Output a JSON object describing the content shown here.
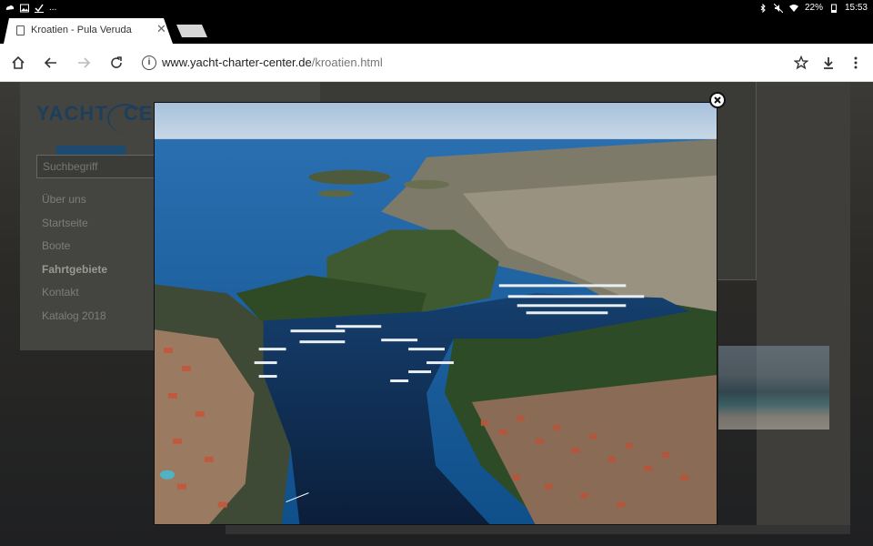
{
  "status_bar": {
    "left_icons": [
      "weather-icon",
      "image-icon",
      "check-icon",
      "more-icon"
    ],
    "more_text": "...",
    "battery": "22%",
    "time": "15:53"
  },
  "tab": {
    "title": "Kroatien - Pula Veruda",
    "close": "✕"
  },
  "toolbar": {
    "url_host": "www.yacht-charter-center.de",
    "url_path": "/kroatien.html"
  },
  "page": {
    "logo_text": "YACHT",
    "logo_text_2": "CEN",
    "search_placeholder": "Suchbegriff",
    "nav": [
      {
        "label": "Über uns"
      },
      {
        "label": "Startseite"
      },
      {
        "label": "Boote"
      },
      {
        "label": "Fahrtgebiete",
        "active": true
      },
      {
        "label": "Kontakt"
      },
      {
        "label": "Katalog 2018"
      }
    ]
  },
  "lightbox": {
    "image": "aerial-photo-pula-veruda-marina",
    "close_icon": "close-icon"
  },
  "colors": {
    "ocean": "#0f4f8a",
    "land_forest": "#2d4b26",
    "accent_logo": "#1d3f5c"
  }
}
